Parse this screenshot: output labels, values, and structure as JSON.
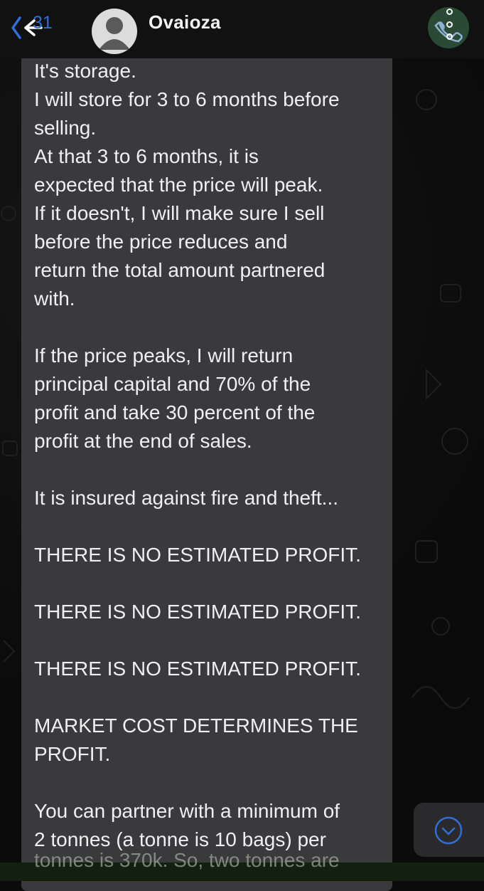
{
  "header": {
    "back_count": "31",
    "contact_name": "Ovaioza"
  },
  "message": {
    "lines": [
      "It's storage.",
      "I will store for 3 to 6 months before",
      "selling.",
      "At that 3 to 6 months, it is",
      "expected that the price will peak.",
      "If it doesn't, I will make sure I sell",
      "before the price reduces and",
      "return the total amount partnered",
      "with.",
      "",
      "If the price peaks, I will return",
      "principal capital and 70% of the",
      "profit and take 30 percent of the",
      "profit at the end of sales.",
      "",
      "It is insured against fire and theft...",
      "",
      "THERE IS NO ESTIMATED PROFIT.",
      "",
      "THERE IS NO ESTIMATED PROFIT.",
      "",
      "THERE IS NO ESTIMATED PROFIT.",
      "",
      "MARKET COST DETERMINES THE",
      "PROFIT.",
      "",
      "You can partner with a minimum of",
      "2 tonnes (a tonne is 10 bags) per"
    ],
    "cut_off_line": "tonnes is 370k. So, two tonnes are"
  },
  "icons": {
    "back": "back-arrow-icon",
    "call": "phone-icon",
    "more": "more-options-icon",
    "scroll": "chevron-down-circle-icon"
  },
  "colors": {
    "accent": "#2f6fd6",
    "bubble": "#3a3a3c",
    "background": "#0b0b0b"
  }
}
